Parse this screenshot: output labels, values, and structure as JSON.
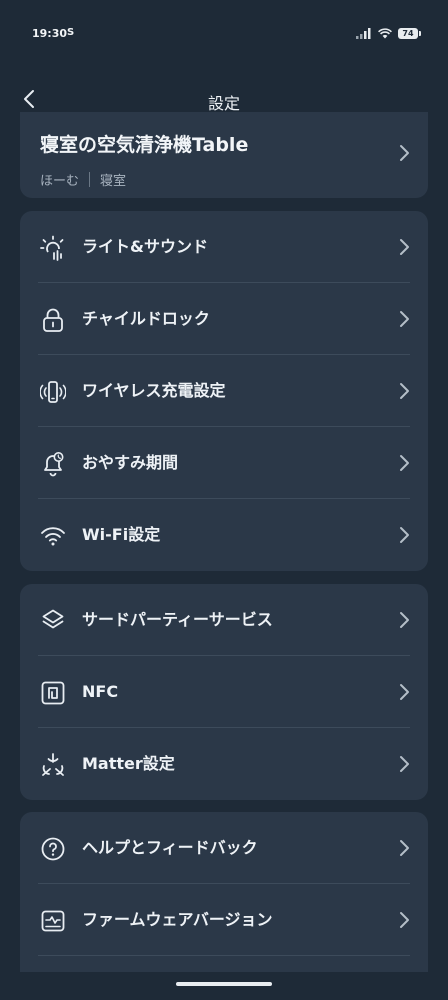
{
  "status_bar": {
    "time": "19:30",
    "indicator": "S",
    "battery": "74"
  },
  "header": {
    "title": "設定"
  },
  "device": {
    "name": "寝室の空気清浄機Table",
    "home": "ほーむ",
    "room": "寝室"
  },
  "group1": [
    {
      "label": "ライト&サウンド",
      "icon": "light-sound-icon"
    },
    {
      "label": "チャイルドロック",
      "icon": "lock-icon"
    },
    {
      "label": "ワイヤレス充電設定",
      "icon": "wireless-charging-icon"
    },
    {
      "label": "おやすみ期間",
      "icon": "bell-moon-icon"
    },
    {
      "label": "Wi-Fi設定",
      "icon": "wifi-icon"
    }
  ],
  "group2": [
    {
      "label": "サードパーティーサービス",
      "icon": "layers-icon"
    },
    {
      "label": "NFC",
      "icon": "nfc-icon"
    },
    {
      "label": "Matter設定",
      "icon": "matter-icon"
    }
  ],
  "group3": [
    {
      "label": "ヘルプとフィードバック",
      "icon": "help-icon"
    },
    {
      "label": "ファームウェアバージョン",
      "icon": "firmware-icon"
    }
  ],
  "colors": {
    "background": "#1e2a37",
    "card": "#2b3848",
    "text": "#eef2f6",
    "subtext": "#a9b4c0"
  }
}
